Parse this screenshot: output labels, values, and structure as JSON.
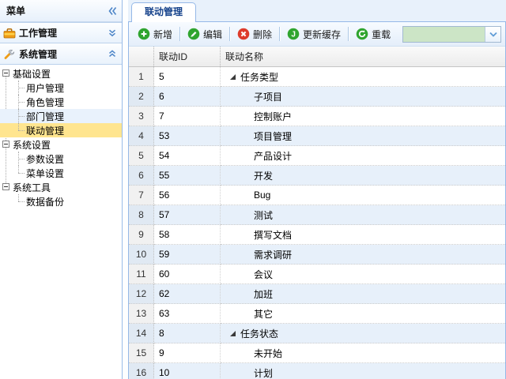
{
  "colors": {
    "panel_border": "#95b8e7",
    "tab_text": "#15428b",
    "tree_selected_bg": "#ffe58f",
    "tree_hover_bg": "#e9f2fc",
    "grid_alt_row_bg": "#e7f0fa",
    "icon_green": "#2fa42f",
    "icon_red": "#dd3b2b",
    "combo_bg": "#cce5c6",
    "chevron_blue": "#4e86c8"
  },
  "sidebar": {
    "title": "菜单",
    "accordions": [
      {
        "label": "工作管理",
        "icon": "toolbox-icon",
        "chevron": "double-down"
      },
      {
        "label": "系统管理",
        "icon": "wrench-icon",
        "chevron": "double-up"
      }
    ],
    "tree": [
      {
        "label": "基础设置",
        "level": "root"
      },
      {
        "label": "用户管理",
        "level": "child"
      },
      {
        "label": "角色管理",
        "level": "child"
      },
      {
        "label": "部门管理",
        "level": "child",
        "state": "hover"
      },
      {
        "label": "联动管理",
        "level": "child",
        "state": "selected",
        "last": true
      },
      {
        "label": "系统设置",
        "level": "root"
      },
      {
        "label": "参数设置",
        "level": "child"
      },
      {
        "label": "菜单设置",
        "level": "child",
        "last": true
      },
      {
        "label": "系统工具",
        "level": "root"
      },
      {
        "label": "数据备份",
        "level": "child",
        "last": true
      }
    ]
  },
  "main": {
    "tab_label": "联动管理",
    "toolbar": {
      "buttons": [
        {
          "label": "新增",
          "icon": "add-icon"
        },
        {
          "label": "编辑",
          "icon": "edit-icon"
        },
        {
          "label": "删除",
          "icon": "delete-icon"
        },
        {
          "label": "更新缓存",
          "icon": "update-cache-icon"
        },
        {
          "label": "重载",
          "icon": "reload-icon"
        }
      ],
      "combobox": {
        "value": ""
      }
    },
    "grid": {
      "columns": [
        {
          "key": "rownum",
          "label": ""
        },
        {
          "key": "id",
          "label": "联动ID"
        },
        {
          "key": "name",
          "label": "联动名称"
        }
      ],
      "rows": [
        {
          "num": "1",
          "id": "5",
          "name": "任务类型",
          "tree": "parent"
        },
        {
          "num": "2",
          "id": "6",
          "name": "子项目",
          "tree": "child"
        },
        {
          "num": "3",
          "id": "7",
          "name": "控制账户",
          "tree": "child"
        },
        {
          "num": "4",
          "id": "53",
          "name": "项目管理",
          "tree": "child"
        },
        {
          "num": "5",
          "id": "54",
          "name": "产品设计",
          "tree": "child"
        },
        {
          "num": "6",
          "id": "55",
          "name": "开发",
          "tree": "child"
        },
        {
          "num": "7",
          "id": "56",
          "name": "Bug",
          "tree": "child"
        },
        {
          "num": "8",
          "id": "57",
          "name": "测试",
          "tree": "child"
        },
        {
          "num": "9",
          "id": "58",
          "name": "撰写文档",
          "tree": "child"
        },
        {
          "num": "10",
          "id": "59",
          "name": "需求调研",
          "tree": "child"
        },
        {
          "num": "11",
          "id": "60",
          "name": "会议",
          "tree": "child"
        },
        {
          "num": "12",
          "id": "62",
          "name": "加班",
          "tree": "child"
        },
        {
          "num": "13",
          "id": "63",
          "name": "其它",
          "tree": "child"
        },
        {
          "num": "14",
          "id": "8",
          "name": "任务状态",
          "tree": "parent"
        },
        {
          "num": "15",
          "id": "9",
          "name": "未开始",
          "tree": "child"
        },
        {
          "num": "16",
          "id": "10",
          "name": "计划",
          "tree": "child"
        }
      ]
    }
  }
}
